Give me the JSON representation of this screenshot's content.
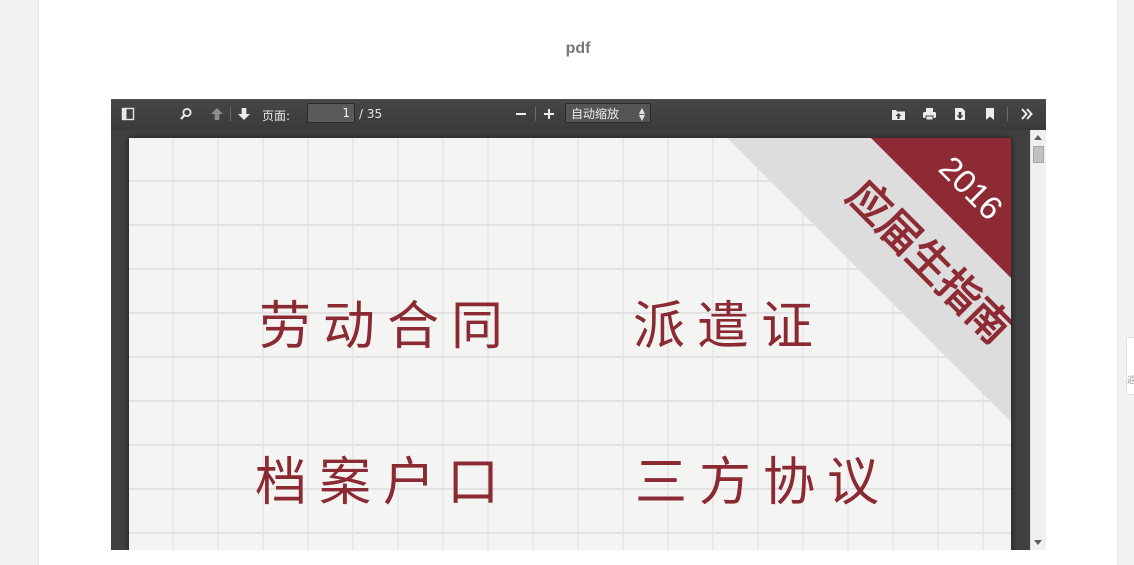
{
  "page": {
    "title": "pdf"
  },
  "toolbar": {
    "page_label": "页面:",
    "page_number": "1",
    "page_total": "/ 35",
    "zoom_value": "自动缩放"
  },
  "icons": {
    "sidebar_toggle": "sidebar-toggle-icon",
    "find": "search-icon",
    "prev_page": "arrow-up-icon",
    "next_page": "arrow-down-icon",
    "zoom_out": "minus-icon",
    "zoom_in": "plus-icon",
    "open_file": "open-file-icon",
    "print": "print-icon",
    "download": "download-icon",
    "bookmark": "bookmark-icon",
    "tools": "double-chevron-right-icon"
  },
  "document": {
    "banner_year": "2016",
    "banner_text": "应届生指南",
    "topics": [
      "劳动合同",
      "派遣证",
      "档案户口",
      "三方协议"
    ]
  },
  "side_tab": {
    "label": "返"
  },
  "colors": {
    "accent_red": "#8b2a33",
    "banner_red": "#8e2a33",
    "banner_grey": "#dddddd",
    "toolbar_bg": "#404040"
  }
}
